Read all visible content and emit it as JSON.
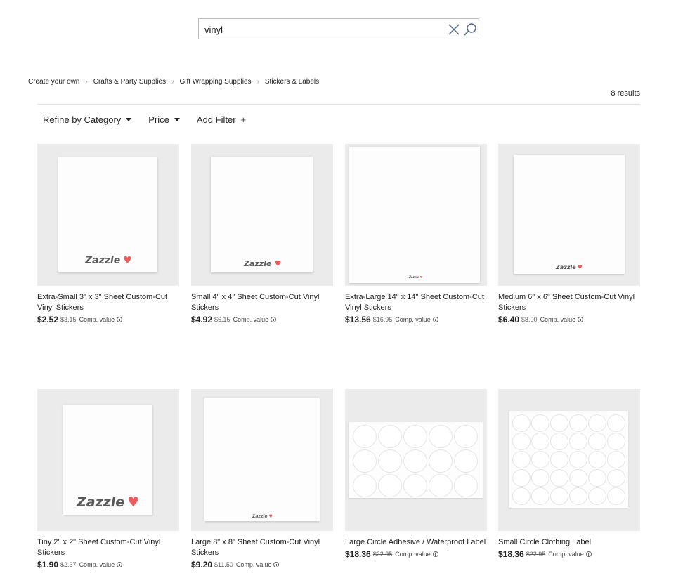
{
  "search": {
    "value": "vinyl",
    "placeholder": ""
  },
  "breadcrumb": [
    "Create your own",
    "Crafts & Party Supplies",
    "Gift Wrapping Supplies",
    "Stickers & Labels"
  ],
  "result_count": "8 results",
  "filters": {
    "category": "Refine by Category",
    "price": "Price",
    "add_filter": "Add Filter"
  },
  "products": [
    {
      "title": "Extra-Small 3\" x 3\" Sheet Custom-Cut Vinyl Stickers",
      "price": "$2.52",
      "orig": "$3.15",
      "comp": "Comp. value",
      "logo": "Zazzle"
    },
    {
      "title": "Small 4\" x 4\" Sheet Custom-Cut Vinyl Stickers",
      "price": "$4.92",
      "orig": "$6.15",
      "comp": "Comp. value",
      "logo": "Zazzle"
    },
    {
      "title": "Extra-Large 14\" x 14\" Sheet Custom-Cut Vinyl Stickers",
      "price": "$13.56",
      "orig": "$16.95",
      "comp": "Comp. value",
      "logo": "Zazzle"
    },
    {
      "title": "Medium 6\" x 6\" Sheet Custom-Cut Vinyl Stickers",
      "price": "$6.40",
      "orig": "$8.00",
      "comp": "Comp. value",
      "logo": "Zazzle"
    },
    {
      "title": "Tiny 2\" x 2\" Sheet Custom-Cut Vinyl Stickers",
      "price": "$1.90",
      "orig": "$2.37",
      "comp": "Comp. value",
      "logo": "Zazzle"
    },
    {
      "title": "Large 8\" x 8\" Sheet Custom-Cut Vinyl Stickers",
      "price": "$9.20",
      "orig": "$11.50",
      "comp": "Comp. value",
      "logo": "Zazzle"
    },
    {
      "title": "Large Circle Adhesive / Waterproof Label",
      "price": "$18.36",
      "orig": "$22.95",
      "comp": "Comp. value"
    },
    {
      "title": "Small Circle Clothing Label",
      "price": "$18.36",
      "orig": "$22.95",
      "comp": "Comp. value"
    }
  ],
  "colors": {
    "accent_heart": "#e85d5d",
    "thumb_bg": "#ebebeb",
    "divider": "#e0e0e0"
  },
  "icons": {
    "clear": "close-icon",
    "search": "search-icon",
    "info": "info-icon",
    "heart": "heart-icon"
  }
}
